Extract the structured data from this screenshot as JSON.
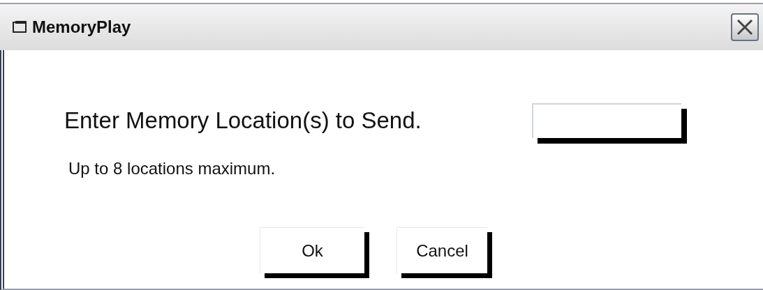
{
  "window": {
    "title": "MemoryPlay"
  },
  "prompt": "Enter Memory Location(s) to Send.",
  "hint": "Up to 8 locations maximum.",
  "buttons": [
    "Ok",
    "Cancel"
  ]
}
